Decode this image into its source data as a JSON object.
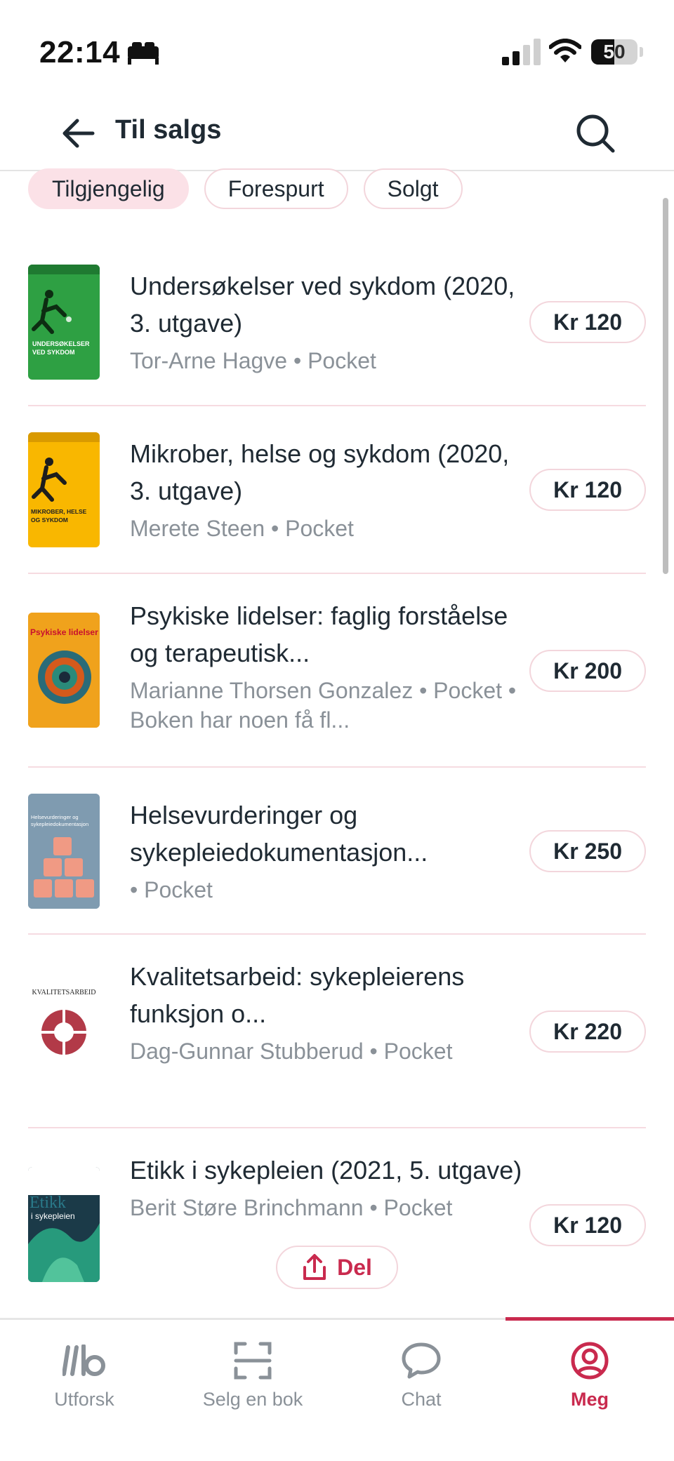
{
  "status_bar": {
    "time": "22:14",
    "battery": "50"
  },
  "header": {
    "title": "Til salgs"
  },
  "filters": [
    {
      "label": "Tilgjengelig",
      "active": true
    },
    {
      "label": "Forespurt",
      "active": false
    },
    {
      "label": "Solgt",
      "active": false
    }
  ],
  "listings": [
    {
      "title": "Undersøkelser ved sykdom (2020, 3. utgave)",
      "meta": "Tor-Arne Hagve • Pocket",
      "price": "Kr 120"
    },
    {
      "title": "Mikrober, helse og sykdom (2020, 3. utgave)",
      "meta": "Merete Steen • Pocket",
      "price": "Kr 120"
    },
    {
      "title": "Psykiske lidelser: faglig forståelse og terapeutisk...",
      "meta": "Marianne Thorsen Gonzalez • Pocket • Boken har noen få fl...",
      "price": "Kr 200"
    },
    {
      "title": "Helsevurderinger og sykepleiedokumentasjon...",
      "meta": " • Pocket",
      "price": "Kr 250"
    },
    {
      "title": "Kvalitetsarbeid: sykepleierens funksjon o...",
      "meta": "Dag-Gunnar Stubberud • Pocket",
      "price": "Kr 220"
    },
    {
      "title": "Etikk i sykepleien (2021, 5. utgave)",
      "meta": "Berit Støre Brinchmann • Pocket",
      "price": "Kr 120"
    }
  ],
  "covers": [
    {
      "lines": [
        "UNDERSØKELSER",
        "VED SYKDOM"
      ],
      "bg": "#2ea043"
    },
    {
      "lines": [
        "MIKROBER, HELSE",
        "OG SYKDOM"
      ],
      "bg": "#f9b700"
    },
    {
      "lines": [
        "Psykiske lidelser"
      ],
      "bg": "#f0a21c"
    },
    {
      "lines": [
        "Helsevurderinger og",
        "sykepleiedokumentasjon"
      ],
      "bg": "#8aa4b8"
    },
    {
      "lines": [
        "KVALITETSARBEID"
      ],
      "bg": "#ffffff"
    },
    {
      "lines": [
        "Etikk",
        "i sykepleien"
      ],
      "bg": "#1b3a48"
    }
  ],
  "share": {
    "label": "Del"
  },
  "tabs": [
    {
      "label": "Utforsk",
      "icon": "library-logo-icon"
    },
    {
      "label": "Selg en bok",
      "icon": "scan-icon"
    },
    {
      "label": "Chat",
      "icon": "chat-bubble-icon"
    },
    {
      "label": "Meg",
      "icon": "user-icon",
      "active": true
    }
  ],
  "colors": {
    "accent": "#c92a4e",
    "chip_active_bg": "#fbe1e7",
    "divider": "#f6dbe1",
    "muted_text": "#8a9198"
  }
}
